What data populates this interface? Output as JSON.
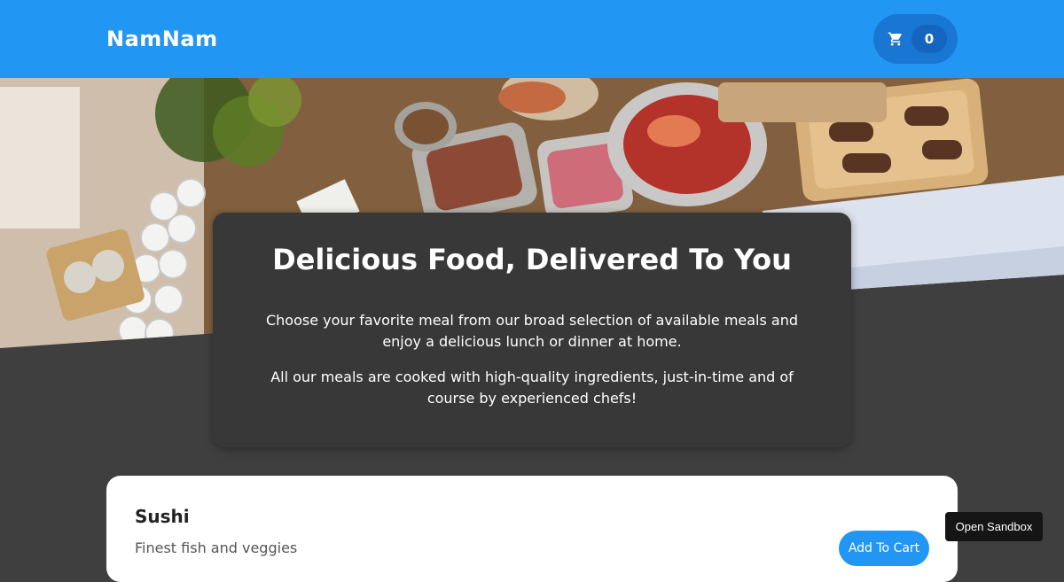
{
  "header": {
    "brand": "NamNam",
    "cart": {
      "icon": "cart-icon",
      "count": "0"
    }
  },
  "hero": {
    "image": "catering-buffet-food-photo"
  },
  "summary": {
    "title": "Delicious Food, Delivered To You",
    "paragraph1": "Choose your favorite meal from our broad selection of available meals and enjoy a delicious lunch or dinner at home.",
    "paragraph2": "All our meals are cooked with high-quality ingredients, just-in-time and of course by experienced chefs!"
  },
  "meals": [
    {
      "name": "Sushi",
      "description": "Finest fish and veggies",
      "add_label": "Add To Cart"
    }
  ],
  "sandbox": {
    "label": "Open Sandbox"
  },
  "colors": {
    "primary": "#2196f3",
    "primary_dark": "#1976d2",
    "background": "#3f3f3f",
    "card_dark": "#383838"
  }
}
